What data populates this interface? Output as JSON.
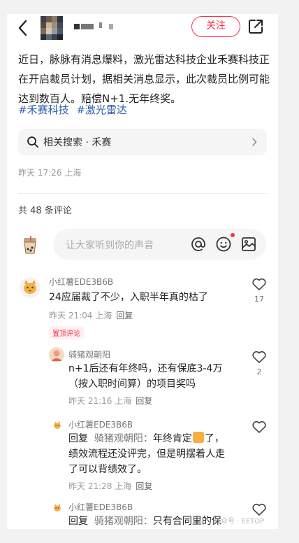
{
  "header": {
    "follow_label": "关注",
    "name_obscured": "▪▪▪  ▪"
  },
  "post": {
    "content": "近日，脉脉有消息爆料，激光雷达科技企业禾赛科技正在开启裁员计划，据相关消息显示，此次裁员比例可能达到数百人。赔偿N+1.无年终奖。",
    "tags": [
      "#禾赛科技",
      "#激光雷达"
    ],
    "related_search": "相关搜索 · 禾赛",
    "timestamp": "昨天 17:26 上海"
  },
  "comments_header": {
    "count_label": "共 48 条评论"
  },
  "comment_input": {
    "placeholder": "让大家听到你的声音"
  },
  "comments": [
    {
      "author": "小红薯EDE3B6B",
      "text": "24应届裁了不少，入职半年真的枯了",
      "meta": "昨天 21:04 上海",
      "reply_label": "回复",
      "like_count": "17",
      "pinned_label": "置顶评论"
    },
    {
      "author": "骑猪观朝阳",
      "text_line1": "n+1后还有年终吗，还有保底3-4万",
      "text_line2": "（按入职时间算）的项目奖吗",
      "meta": "昨天 21:16 上海",
      "reply_label": "回复",
      "like_count": "2"
    },
    {
      "author": "小红薯EDE3B6B",
      "reply_prefix": "回复",
      "reply_to": "骑猪观朝阳：",
      "text_line1a": "年终肯定",
      "text_line1b": "了，",
      "text_line2": "绩效流程还没评完，但是明摆着人走",
      "text_line3": "了可以背绩效了。",
      "meta": "昨天 21:28 上海",
      "reply_label": "回复"
    },
    {
      "author": "小红薯EDE3B6B",
      "reply_prefix": "回复",
      "reply_to": "骑猪观朝阳：",
      "text_line1": "只有合同里的保"
    }
  ],
  "watermark": "公众号 · EETOP",
  "colors": {
    "accent": "#ff2e4d",
    "tag": "#2b5ea8",
    "muted": "#999999"
  }
}
